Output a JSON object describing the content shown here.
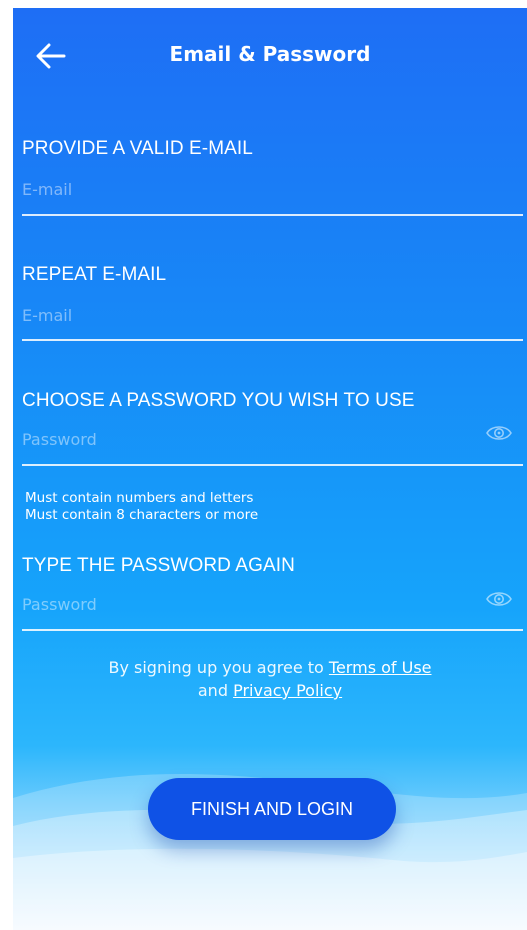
{
  "header": {
    "title": "Email & Password"
  },
  "form": {
    "email": {
      "label": "PROVIDE A VALID E-MAIL",
      "placeholder": "E-mail"
    },
    "repeat_email": {
      "label": "REPEAT E-MAIL",
      "placeholder": "E-mail"
    },
    "password": {
      "label": "CHOOSE A PASSWORD YOU WISH TO USE",
      "placeholder": "Password"
    },
    "hints": [
      "Must contain numbers and letters",
      "Must contain 8 characters or more"
    ],
    "repeat_password": {
      "label": "TYPE THE PASSWORD AGAIN",
      "placeholder": "Password"
    }
  },
  "terms": {
    "prefix": "By signing up you agree to",
    "terms_link": "Terms of Use",
    "middle": "and",
    "privacy_link": "Privacy Policy"
  },
  "actions": {
    "finish_label": "FINISH AND LOGIN"
  },
  "icons": {
    "back": "arrow-left-icon",
    "show_password": "eye-icon"
  },
  "colors": {
    "gradient_top": "#1e6ef5",
    "gradient_bottom": "#eaf5ff",
    "button": "#0f52e6",
    "text": "#ffffff"
  }
}
